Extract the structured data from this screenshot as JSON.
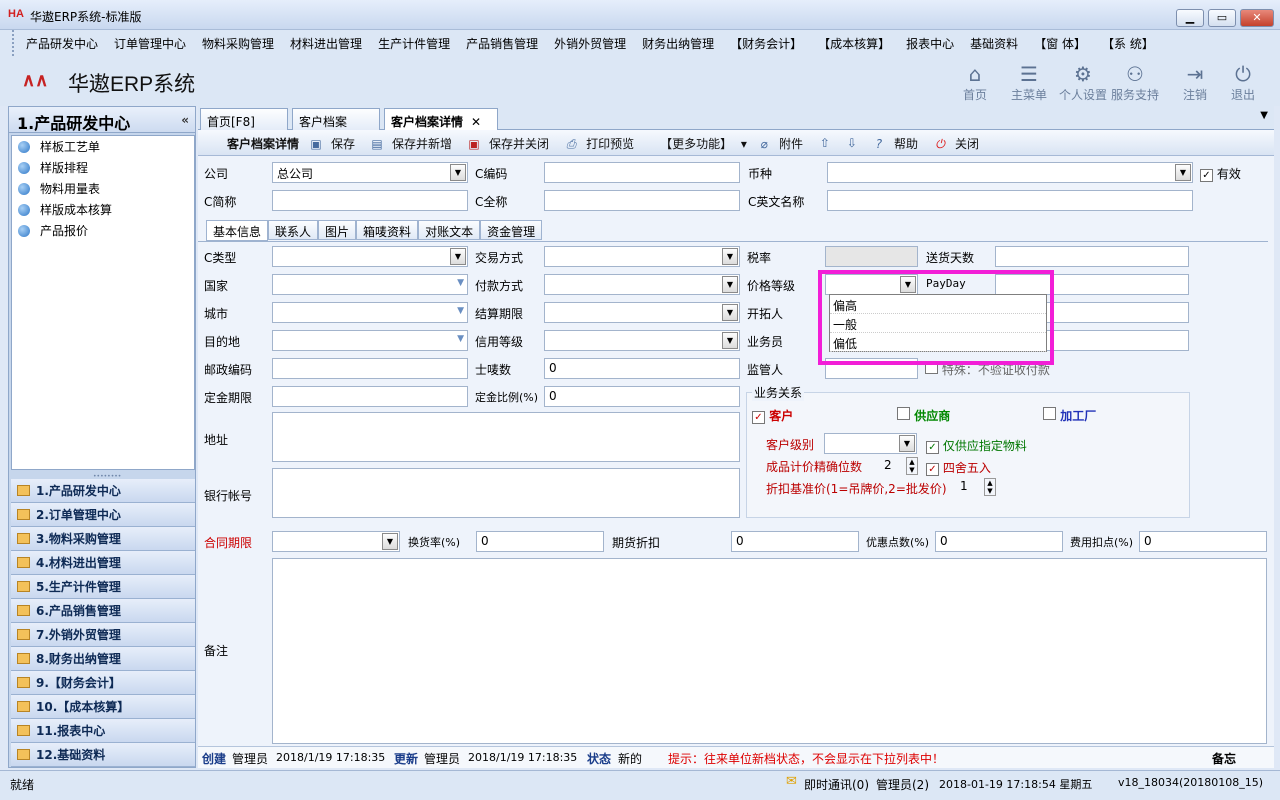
{
  "window": {
    "title": "华遨ERP系统-标准版",
    "logo": "HA"
  },
  "menubar": [
    "产品研发中心",
    "订单管理中心",
    "物料采购管理",
    "材料进出管理",
    "生产计件管理",
    "产品销售管理",
    "外销外贸管理",
    "财务出纳管理",
    "【财务会计】",
    "【成本核算】",
    "报表中心",
    "基础资料",
    "【窗 体】",
    "【系 统】"
  ],
  "brand": "华遨ERP系统",
  "toolbar": [
    {
      "icon": "home-icon",
      "label": "首页"
    },
    {
      "icon": "list-icon",
      "label": "主菜单"
    },
    {
      "icon": "gear-icon",
      "label": "个人设置"
    },
    {
      "icon": "support-icon",
      "label": "服务支持"
    },
    {
      "icon": "logout-icon",
      "label": "注销"
    },
    {
      "icon": "power-icon",
      "label": "退出"
    }
  ],
  "sidebar": {
    "header": "1.产品研发中心",
    "collapse": "«",
    "items": [
      "样板工艺单",
      "样版排程",
      "物料用量表",
      "样版成本核算",
      "产品报价"
    ],
    "modules": [
      "1.产品研发中心",
      "2.订单管理中心",
      "3.物料采购管理",
      "4.材料进出管理",
      "5.生产计件管理",
      "6.产品销售管理",
      "7.外销外贸管理",
      "8.财务出纳管理",
      "9.【财务会计】",
      "10.【成本核算】",
      "11.报表中心",
      "12.基础资料"
    ]
  },
  "tabs": [
    "首页[F8]",
    "客户档案",
    "客户档案详情"
  ],
  "subtoolbar": {
    "title": "客户档案详情",
    "save": "保存",
    "save_new": "保存并新增",
    "save_close": "保存并关闭",
    "print": "打印预览",
    "more": "【更多功能】",
    "attach": "附件",
    "help": "帮助",
    "close": "关闭"
  },
  "header_fields": {
    "company_label": "公司",
    "company_value": "总公司",
    "ccode_label": "C编码",
    "currency_label": "币种",
    "valid_label": "有效",
    "cshort_label": "C简称",
    "cfull_label": "C全称",
    "cen_label": "C英文名称"
  },
  "inner_tabs": [
    "基本信息",
    "联系人",
    "图片",
    "箱唛资料",
    "对账文本",
    "资金管理"
  ],
  "form": {
    "ctype": "C类型",
    "trade": "交易方式",
    "tax": "税率",
    "delivery_days": "送货天数",
    "country": "国家",
    "payment": "付款方式",
    "price_level": "价格等级",
    "payday": "PayDay",
    "city": "城市",
    "settle": "结算期限",
    "developer": "开拓人",
    "dest": "目的地",
    "credit": "信用等级",
    "salesman": "业务员",
    "zip": "邮政编码",
    "shimai": "士唛数",
    "shimai_val": "0",
    "supervisor": "监管人",
    "special": "特殊：不验证收付款",
    "deposit_period": "定金期限",
    "deposit_ratio": "定金比例(%)",
    "deposit_ratio_val": "0",
    "address": "地址",
    "bank": "银行帐号",
    "contract": "合同期限",
    "exchange": "换货率(%)",
    "exchange_val": "0",
    "futures": "期货折扣",
    "futures_val": "0",
    "promo": "优惠点数(%)",
    "promo_val": "0",
    "fee": "费用扣点(%)",
    "fee_val": "0",
    "remark": "备注"
  },
  "business": {
    "title": "业务关系",
    "customer": "客户",
    "supplier": "供应商",
    "factory": "加工厂",
    "level": "客户级别",
    "only_supply": "仅供应指定物料",
    "precision": "成品计价精确位数",
    "precision_val": "2",
    "round": "四舍五入",
    "discount_base": "折扣基准价(1=吊牌价,2=批发价)",
    "discount_val": "1"
  },
  "dropdown": [
    "偏高",
    "一般",
    "偏低"
  ],
  "status": {
    "create": "创建",
    "create_user": "管理员",
    "create_time": "2018/1/19 17:18:35",
    "update": "更新",
    "update_user": "管理员",
    "update_time": "2018/1/19 17:18:35",
    "state": "状态",
    "state_val": "新的",
    "tip": "提示：往来单位新档状态，不会显示在下拉列表中！",
    "memo": "备忘"
  },
  "bottom": {
    "ready": "就绪",
    "im": "即时通讯(0)",
    "user": "管理员(2)",
    "datetime": "2018-01-19  17:18:54 星期五",
    "version": "v18_18034(20180108_15)"
  }
}
